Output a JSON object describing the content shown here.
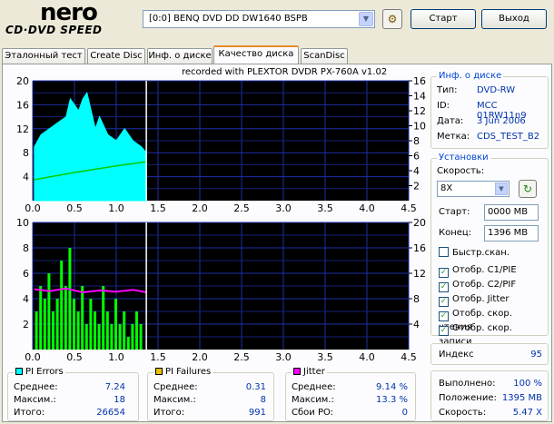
{
  "app": {
    "logo_top": "nero",
    "logo_bottom": "CD·DVD SPEED"
  },
  "drive": {
    "value": "[0:0]  BENQ DVD DD DW1640 BSPB"
  },
  "buttons": {
    "start": "Старт",
    "exit": "Выход"
  },
  "tabs": [
    {
      "label": "Эталонный тест",
      "active": false
    },
    {
      "label": "Create Disc",
      "active": false
    },
    {
      "label": "Инф. о диске",
      "active": false
    },
    {
      "label": "Качество диска",
      "active": true
    },
    {
      "label": "ScanDisc",
      "active": false
    }
  ],
  "chart_header": "recorded with PLEXTOR DVDR   PX-760A   v1.02",
  "disc_info": {
    "title": "Инф. о диске",
    "rows": [
      {
        "label": "Тип:",
        "value": "DVD-RW"
      },
      {
        "label": "ID:",
        "value": "MCC 01RW11n9"
      },
      {
        "label": "Дата:",
        "value": "3 Jun 2006"
      },
      {
        "label": "Метка:",
        "value": "CDS_TEST_B2"
      }
    ]
  },
  "settings": {
    "title": "Установки",
    "speed_label": "Скорость:",
    "speed_value": "8X",
    "start_label": "Старт:",
    "start_value": "0000 MB",
    "end_label": "Конец:",
    "end_value": "1396 MB",
    "checks": [
      {
        "label": "Быстр.скан.",
        "checked": false
      },
      {
        "label": "Отобр. C1/PIE",
        "checked": true
      },
      {
        "label": "Отобр. C2/PIF",
        "checked": true
      },
      {
        "label": "Отобр. Jitter",
        "checked": true
      },
      {
        "label": "Отобр. скор. чтения",
        "checked": true
      },
      {
        "label": "Отобр. скор. записи",
        "checked": true
      }
    ]
  },
  "index": {
    "label": "Индекс",
    "value": "95"
  },
  "progress": {
    "rows": [
      {
        "label": "Выполнено:",
        "value": "100 %"
      },
      {
        "label": "Положение:",
        "value": "1395 MB"
      },
      {
        "label": "Скорость:",
        "value": "5.47 X"
      }
    ]
  },
  "pi_errors": {
    "title": "PI Errors",
    "color": "#00ffff",
    "rows": [
      {
        "label": "Среднее:",
        "value": "7.24"
      },
      {
        "label": "Максим.:",
        "value": "18"
      },
      {
        "label": "Итого:",
        "value": "26654"
      }
    ]
  },
  "pi_failures": {
    "title": "PI Failures",
    "color": "#e6c300",
    "rows": [
      {
        "label": "Среднее:",
        "value": "0.31"
      },
      {
        "label": "Максим.:",
        "value": "8"
      },
      {
        "label": "Итого:",
        "value": "991"
      }
    ]
  },
  "jitter": {
    "title": "Jitter",
    "color": "#ff00ff",
    "rows": [
      {
        "label": "Среднее:",
        "value": "9.14 %"
      },
      {
        "label": "Максим.:",
        "value": "13.3 %"
      },
      {
        "label": "Сбои PO:",
        "value": "0"
      }
    ]
  },
  "chart_data": [
    {
      "type": "area",
      "xlim": [
        0,
        4.5
      ],
      "ylim_left": [
        0,
        20
      ],
      "ylim_right": [
        0,
        16
      ],
      "x_ticks": [
        "0.0",
        "0.5",
        "1.0",
        "1.5",
        "2.0",
        "2.5",
        "3.0",
        "3.5",
        "4.0",
        "4.5"
      ],
      "y_ticks_left": [
        "20",
        "16",
        "12",
        "8",
        "4"
      ],
      "y_ticks_right": [
        "16",
        "14",
        "12",
        "10",
        "8",
        "6",
        "4",
        "2"
      ],
      "series": [
        {
          "name": "PI Errors",
          "color": "#00ffff",
          "x": [
            0.02,
            0.1,
            0.2,
            0.3,
            0.4,
            0.45,
            0.5,
            0.55,
            0.6,
            0.65,
            0.7,
            0.75,
            0.8,
            0.9,
            1.0,
            1.1,
            1.2,
            1.3,
            1.36
          ],
          "y": [
            9,
            11,
            12,
            13,
            14,
            17,
            16,
            15,
            17,
            18,
            15,
            12,
            14,
            11,
            10,
            12,
            10,
            9,
            8
          ]
        },
        {
          "name": "Write speed",
          "color": "#00cc00",
          "x": [
            0.02,
            0.5,
            1.0,
            1.36
          ],
          "y": [
            3.5,
            4.7,
            5.8,
            6.5
          ]
        }
      ],
      "scan_end": 1.36
    },
    {
      "type": "bar",
      "xlim": [
        0,
        4.5
      ],
      "ylim_left": [
        0,
        10
      ],
      "ylim_right": [
        0,
        20
      ],
      "x_ticks": [
        "0.0",
        "0.5",
        "1.0",
        "1.5",
        "2.0",
        "2.5",
        "3.0",
        "3.5",
        "4.0",
        "4.5"
      ],
      "y_ticks_left": [
        "10",
        "8",
        "6",
        "4",
        "2"
      ],
      "y_ticks_right": [
        "20",
        "16",
        "12",
        "8",
        "4"
      ],
      "series": [
        {
          "name": "PI Failures",
          "color": "#00ff00",
          "x": [
            0.05,
            0.1,
            0.15,
            0.2,
            0.25,
            0.3,
            0.35,
            0.4,
            0.45,
            0.5,
            0.55,
            0.6,
            0.65,
            0.7,
            0.75,
            0.8,
            0.85,
            0.9,
            0.95,
            1.0,
            1.05,
            1.1,
            1.15,
            1.2,
            1.25,
            1.3
          ],
          "y": [
            3,
            5,
            4,
            6,
            3,
            4,
            7,
            5,
            8,
            4,
            3,
            5,
            2,
            4,
            3,
            2,
            5,
            3,
            2,
            4,
            2,
            3,
            1,
            2,
            3,
            2
          ]
        },
        {
          "name": "Jitter",
          "color": "#ff00ff",
          "x": [
            0.02,
            0.2,
            0.4,
            0.6,
            0.8,
            1.0,
            1.2,
            1.36
          ],
          "y": [
            9.5,
            9.2,
            9.6,
            9.0,
            9.3,
            9.1,
            9.4,
            9.0
          ]
        }
      ],
      "scan_end": 1.36
    }
  ]
}
